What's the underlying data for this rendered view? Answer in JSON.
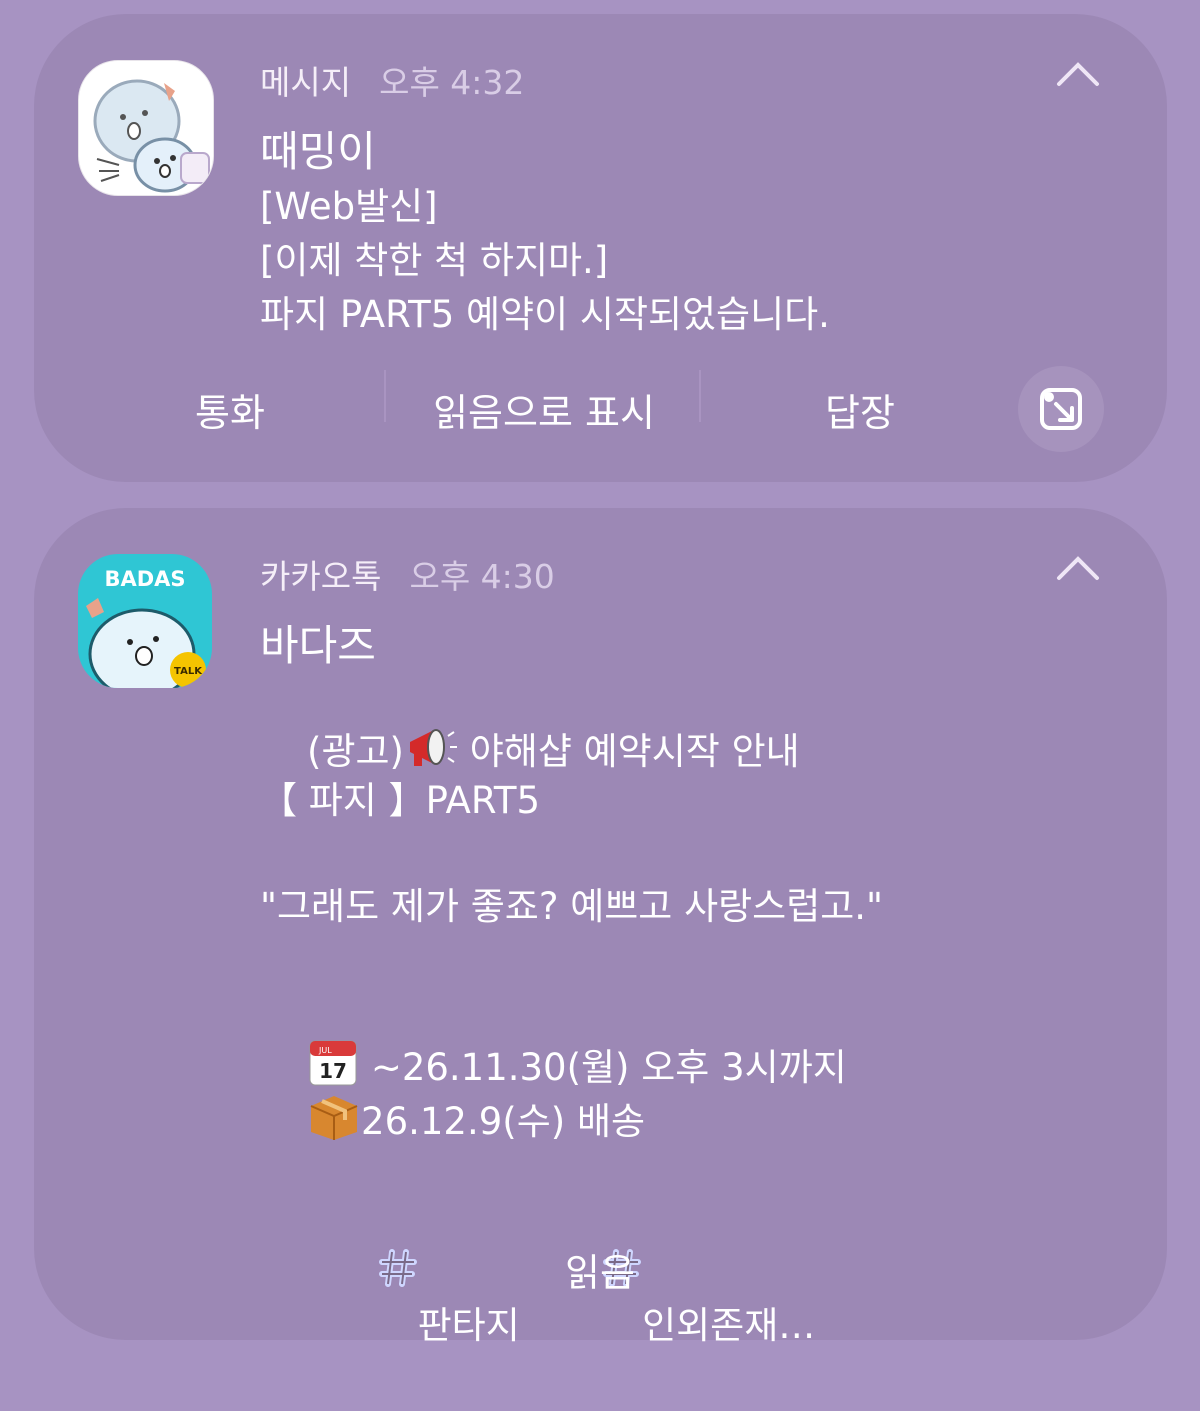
{
  "notifications": [
    {
      "app_name": "메시지",
      "time": "오후 4:32",
      "sender": "때밍이",
      "lines": [
        "[Web발신]",
        "[이제 착한 척 하지마.]",
        "파지 PART5 예약이 시작되었습니다."
      ],
      "actions": {
        "call": "통화",
        "mark_read": "읽음으로 표시",
        "reply": "답장"
      },
      "collapse_icon": "chevron-up-icon",
      "expand_icon": "expand-window-icon"
    },
    {
      "app_name": "카카오톡",
      "time": "오후 4:30",
      "sender": "바다즈",
      "avatar_label": "BADAS",
      "badge_label": "TALK",
      "ad_prefix": "(광고)",
      "ad_text": "야해샵 예약시작 안내",
      "part_line": "【 파지 】PART5",
      "quote": "\"그래도 제가 좋죠? 예쁘고 사랑스럽고.\"",
      "date_text": "~26.11.30(월) 오후 3시까지",
      "ship_text": "26.12.9(수) 배송",
      "hashtags": [
        "판타지",
        "인외존재…"
      ],
      "actions": {
        "read": "읽음"
      },
      "collapse_icon": "chevron-up-icon"
    }
  ],
  "colors": {
    "background": "#a793c2",
    "card": "#9c88b5",
    "accent_badge": "#f5c400"
  },
  "icons": [
    "megaphone-icon",
    "calendar-icon",
    "package-icon",
    "hash-icon"
  ],
  "calendar_icon_text": {
    "month": "JUL",
    "day": "17"
  }
}
